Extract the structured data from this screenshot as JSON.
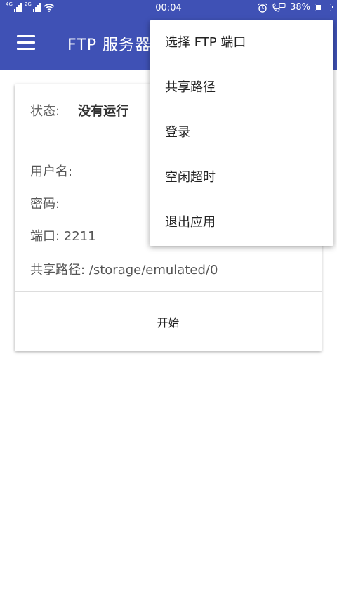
{
  "status_bar": {
    "signal1_label": "4G",
    "signal2_label": "2G",
    "time": "00:04",
    "battery_text": "38%",
    "battery_level": 0.38
  },
  "app_bar": {
    "title": "FTP 服务器"
  },
  "card": {
    "status_key": "状态:",
    "status_value": "没有运行",
    "username_label": "用户名:",
    "password_label": "密码:",
    "port_text": "端口: 2211",
    "path_text": "共享路径: /storage/emulated/0",
    "start_label": "开始"
  },
  "menu": {
    "items": [
      "选择 FTP 端口",
      "共享路径",
      "登录",
      "空闲超时",
      "退出应用"
    ]
  },
  "colors": {
    "primary": "#3F51B5"
  }
}
